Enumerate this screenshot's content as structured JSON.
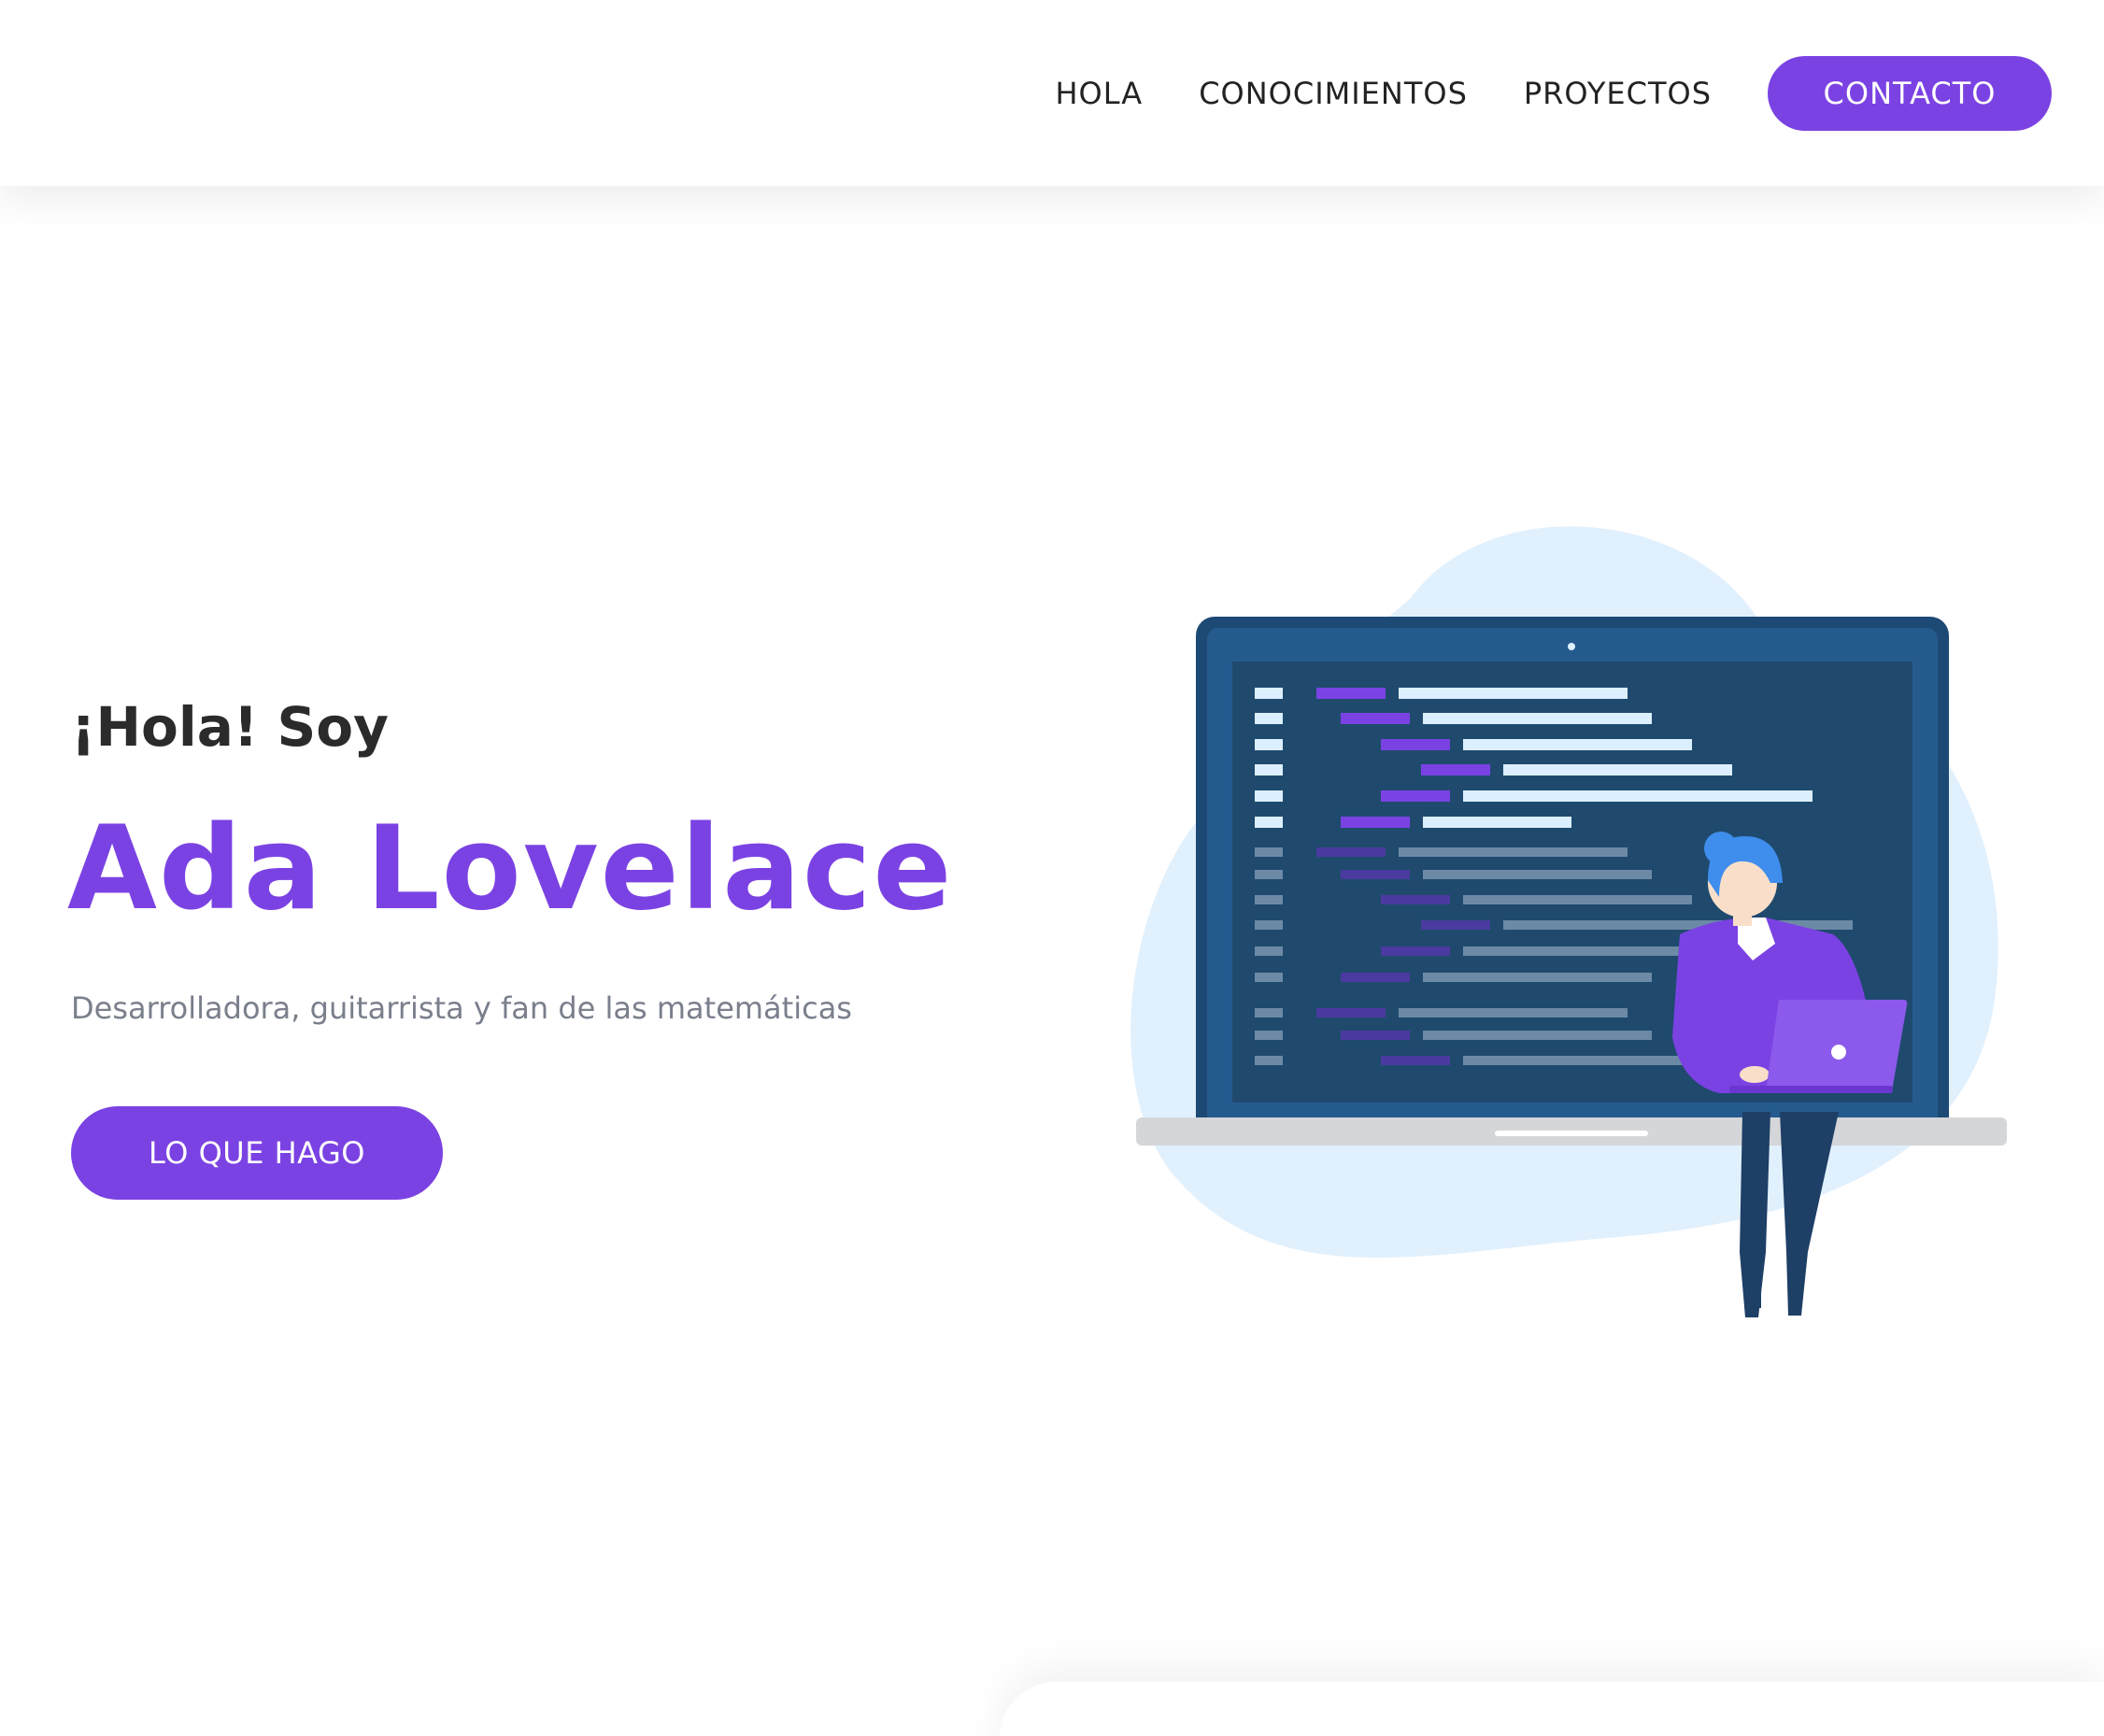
{
  "nav": {
    "links": [
      "HOLA",
      "CONOCIMIENTOS",
      "PROYECTOS"
    ],
    "cta_label": "CONTACTO"
  },
  "hero": {
    "greeting": "¡Hola! Soy",
    "name": "Ada Lovelace",
    "tagline": "Desarrolladora, guitarrista y fan de las matemáticas",
    "cta_label": "LO QUE HAGO"
  },
  "colors": {
    "accent": "#7b42e3",
    "heading": "#2b2b2b",
    "muted_text": "#7a7f8c",
    "monitor_frame": "#23548a",
    "monitor_screen": "#1f4a6e",
    "blob": "#e1f0fd"
  },
  "illustration": {
    "icon": "developer-laptop-illustration"
  }
}
